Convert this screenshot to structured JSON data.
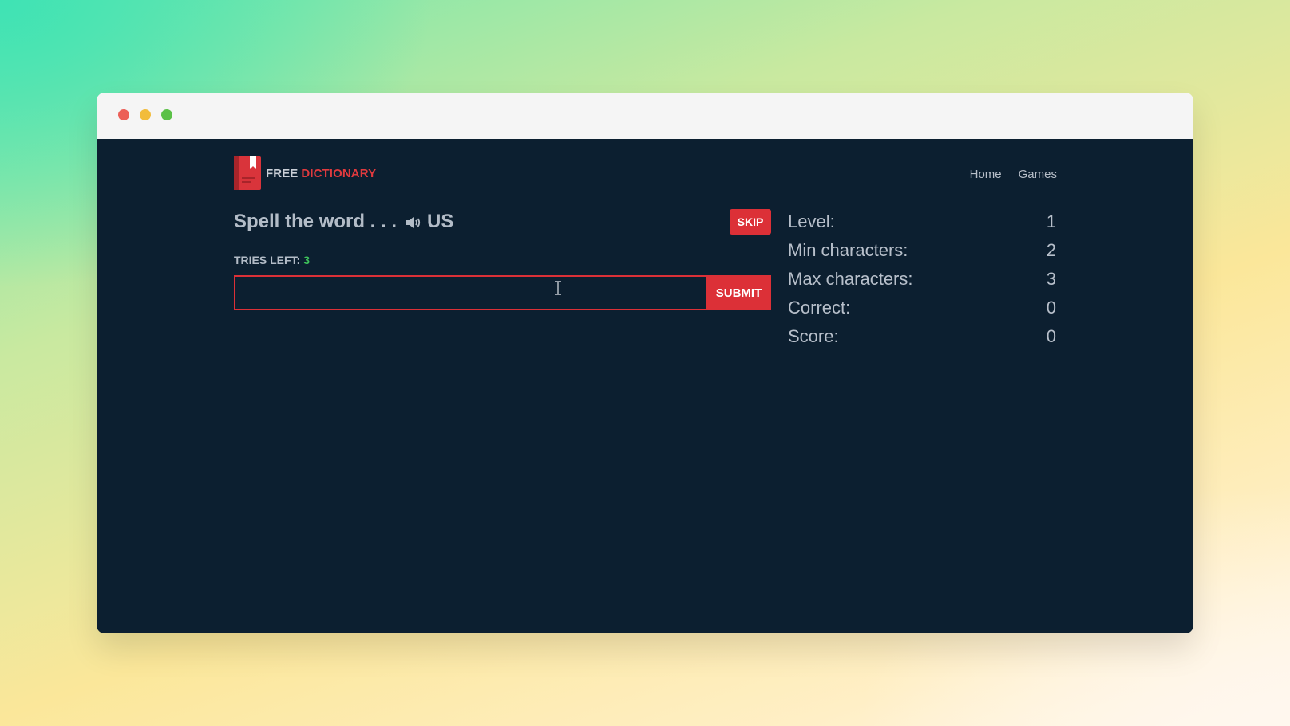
{
  "window": {
    "controls": [
      "close",
      "minimize",
      "maximize"
    ]
  },
  "brand": {
    "free": "FREE",
    "dictionary": "DICTIONARY",
    "icon": "book-icon",
    "colors": {
      "red": "#e03a3e"
    }
  },
  "nav": {
    "items": [
      {
        "label": "Home"
      },
      {
        "label": "Games"
      }
    ]
  },
  "game": {
    "prompt": "Spell the word . . .",
    "speaker_icon": "speaker-icon",
    "accent": "US",
    "skip_label": "SKIP",
    "tries_label": "TRIES LEFT:",
    "tries_left": "3",
    "input_value": "",
    "submit_label": "SUBMIT"
  },
  "stats": [
    {
      "label": "Level:",
      "value": "1"
    },
    {
      "label": "Min characters:",
      "value": "2"
    },
    {
      "label": "Max characters:",
      "value": "3"
    },
    {
      "label": "Correct:",
      "value": "0"
    },
    {
      "label": "Score:",
      "value": "0"
    }
  ],
  "colors": {
    "background": "#0c1f30",
    "accent_red": "#dc3037",
    "tries_green": "#3ec25a"
  }
}
